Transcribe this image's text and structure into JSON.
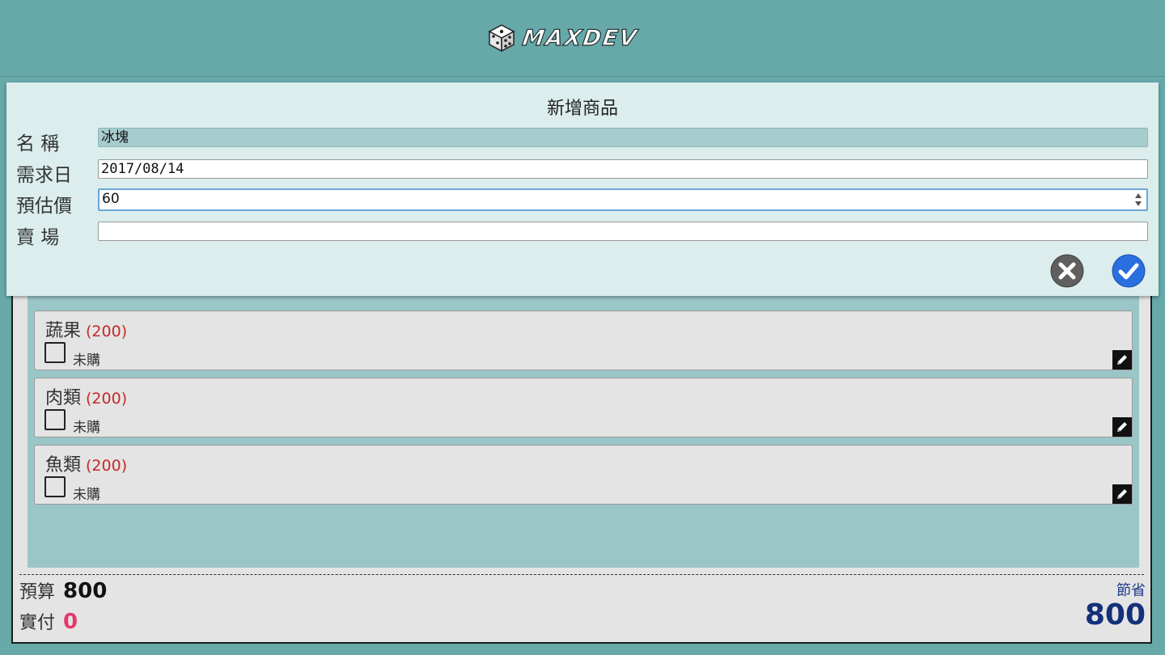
{
  "header": {
    "brand": "MAXDEV"
  },
  "modal": {
    "title": "新增商品",
    "fields": [
      {
        "label": "名 稱",
        "value": "冰塊"
      },
      {
        "label": "需求日",
        "value": "2017/08/14"
      },
      {
        "label": "預估價",
        "value": "60"
      },
      {
        "label": "賣 場",
        "value": ""
      }
    ]
  },
  "items": [
    {
      "title": "蔬果",
      "price": "(200)",
      "status": "未購"
    },
    {
      "title": "肉類",
      "price": "(200)",
      "status": "未購"
    },
    {
      "title": "魚類",
      "price": "(200)",
      "status": "未購"
    }
  ],
  "summary": {
    "budget_label": "預算",
    "budget_value": "800",
    "paid_label": "實付",
    "paid_value": "0",
    "save_label": "節省",
    "save_value": "800"
  },
  "colors": {
    "accent_teal": "#67a8a9",
    "price_red": "#c62828",
    "paid_pink": "#e5386a",
    "save_blue": "#14307a",
    "confirm_blue": "#2a6fe0"
  },
  "icons": {
    "cancel": "close-circle-icon",
    "confirm": "check-circle-icon",
    "edit": "pencil-icon",
    "logo": "dice-icon"
  }
}
